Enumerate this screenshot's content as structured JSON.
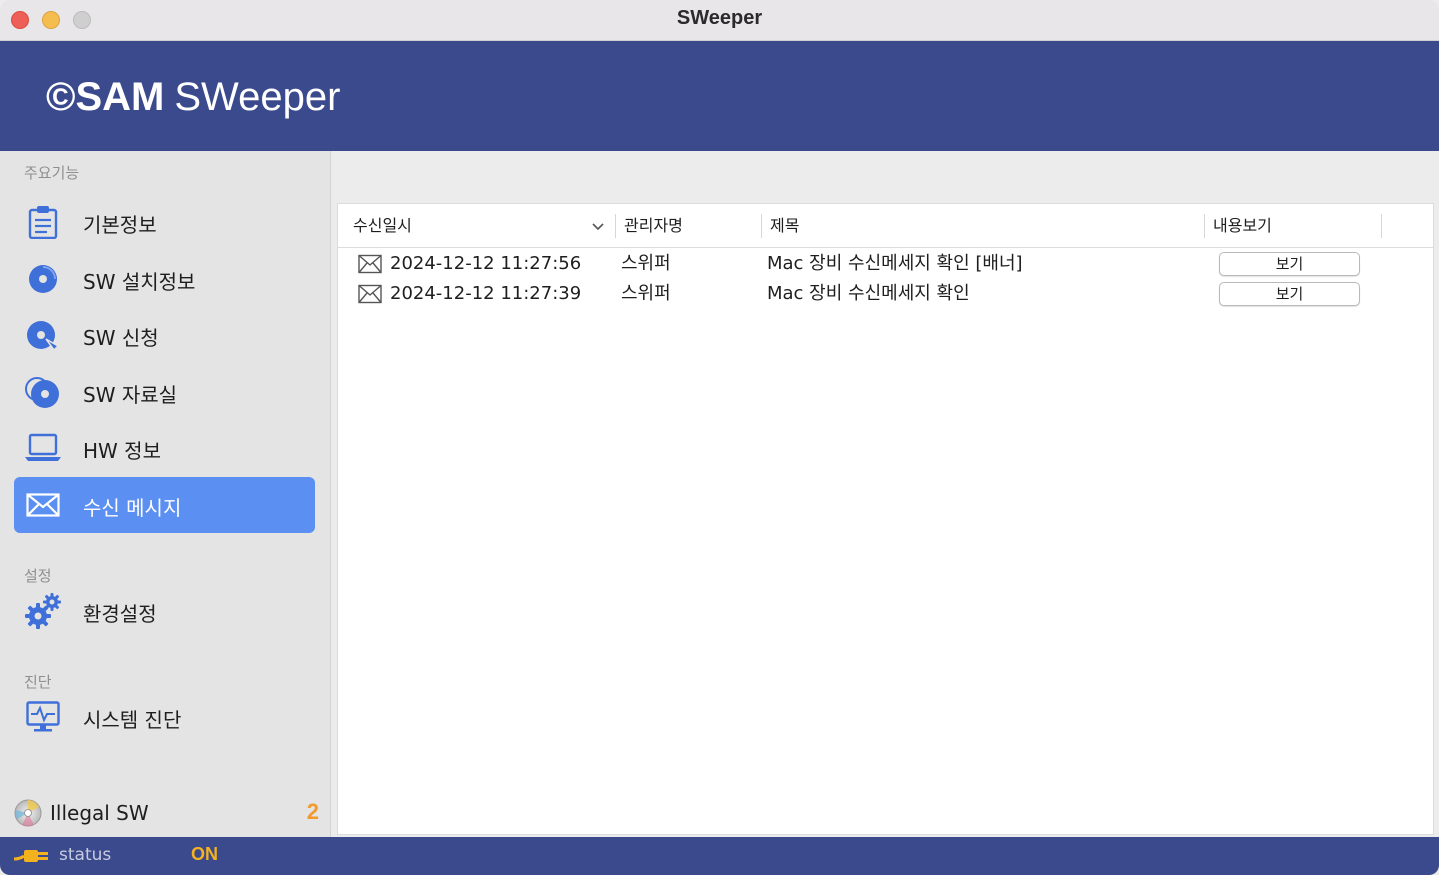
{
  "window": {
    "title": "SWeeper"
  },
  "header": {
    "logo_symbol": "©",
    "logo_brand": "SAM",
    "logo_product": "SWeeper"
  },
  "sidebar": {
    "section_main": "주요기능",
    "items": [
      {
        "label": "기본정보",
        "icon": "clipboard-icon"
      },
      {
        "label": "SW 설치정보",
        "icon": "disc-icon"
      },
      {
        "label": "SW 신청",
        "icon": "disc-request-icon"
      },
      {
        "label": "SW 자료실",
        "icon": "disc-library-icon"
      },
      {
        "label": "HW 정보",
        "icon": "laptop-icon"
      },
      {
        "label": "수신 메시지",
        "icon": "envelope-icon",
        "active": true
      }
    ],
    "section_settings": "설정",
    "settings_item": {
      "label": "환경설정",
      "icon": "gears-icon"
    },
    "section_diagnosis": "진단",
    "diagnosis_item": {
      "label": "시스템 진단",
      "icon": "monitor-pulse-icon"
    },
    "illegal": {
      "label": "Illegal SW",
      "count": "2"
    }
  },
  "table": {
    "columns": [
      "수신일시",
      "관리자명",
      "제목",
      "내용보기"
    ],
    "rows": [
      {
        "received": "2024-12-12 11:27:56",
        "admin": "스위퍼",
        "title": "Mac 장비 수신메세지 확인 [배너]",
        "action": "보기"
      },
      {
        "received": "2024-12-12 11:27:39",
        "admin": "스위퍼",
        "title": "Mac 장비 수신메세지 확인",
        "action": "보기"
      }
    ]
  },
  "status": {
    "label": "status",
    "value": "ON"
  },
  "colors": {
    "brand_blue": "#3b4a8c",
    "active_blue": "#5b8ff2",
    "icon_blue": "#3f6fd8",
    "warning_orange": "#f29a2e",
    "status_yellow": "#f5b21f"
  }
}
